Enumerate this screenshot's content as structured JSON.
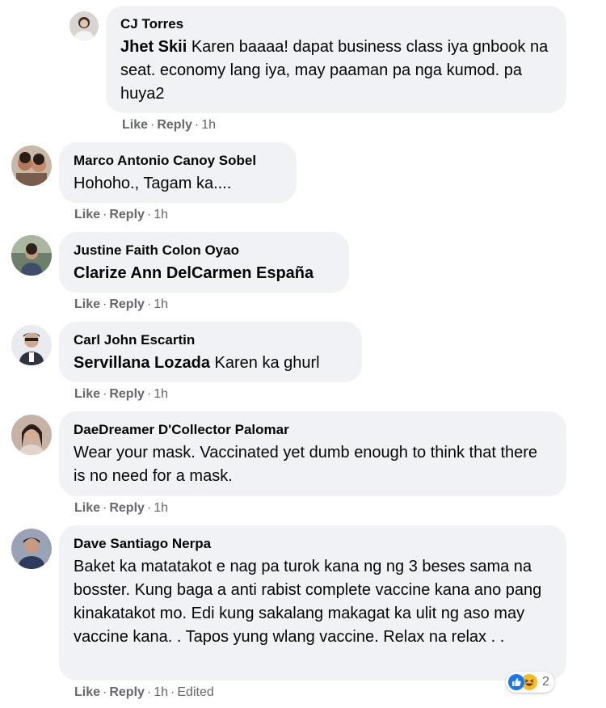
{
  "comments": [
    {
      "author": "CJ Torres",
      "mention": "Jhet Skii",
      "text": " Karen baaaa! dapat business class iya gnbook na seat. economy lang iya, may paaman pa nga kumod. pa huya2",
      "like": "Like",
      "reply": "Reply",
      "time": "1h"
    },
    {
      "author": "Marco Antonio Canoy Sobel",
      "mention": "",
      "text": "Hohoho., Tagam ka....",
      "like": "Like",
      "reply": "Reply",
      "time": "1h"
    },
    {
      "author": "Justine Faith Colon Oyao",
      "mention": "Clarize Ann DelCarmen España",
      "text": "",
      "like": "Like",
      "reply": "Reply",
      "time": "1h"
    },
    {
      "author": "Carl John Escartin",
      "mention": "Servillana Lozada",
      "text": " Karen ka ghurl",
      "like": "Like",
      "reply": "Reply",
      "time": "1h"
    },
    {
      "author": "DaeDreamer D'Collector Palomar",
      "mention": "",
      "text": "Wear your mask. Vaccinated yet dumb enough to think that there is no need for a mask.",
      "like": "Like",
      "reply": "Reply",
      "time": "1h"
    },
    {
      "author": "Dave Santiago Nerpa",
      "mention": "",
      "text": "Baket ka matatakot e nag pa turok kana ng ng 3 beses sama na bosster. Kung baga a anti rabist complete vaccine kana ano pang kinakatakot mo. Edi kung sakalang makagat ka ulit ng aso may vaccine kana. . Tapos yung wlang vaccine. Relax na relax . .",
      "like": "Like",
      "reply": "Reply",
      "time": "1h",
      "edited": "Edited",
      "reactions": {
        "icons": [
          "like-reaction-icon",
          "haha-reaction-icon"
        ],
        "count": "2"
      }
    }
  ],
  "colors": {
    "bubble": "#f0f2f5",
    "meta": "#65676b",
    "like_blue": "#1877f2",
    "haha_yellow": "#f7b928"
  }
}
